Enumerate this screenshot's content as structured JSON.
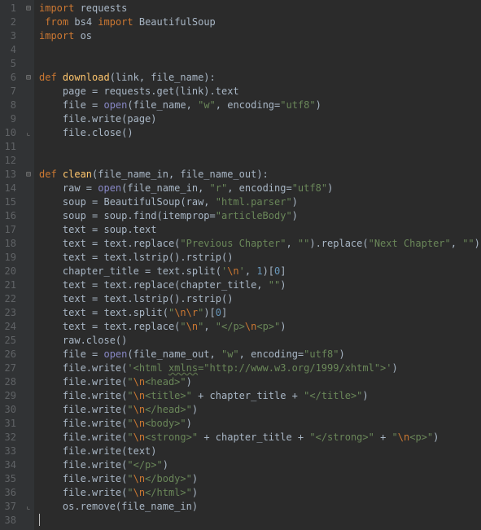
{
  "lines": [
    {
      "n": 1,
      "fold": "minus",
      "html": "<span class='kw'>import</span> requests"
    },
    {
      "n": 2,
      "fold": "",
      "html": " <span class='kw'>from</span> bs4 <span class='kw'>import</span> BeautifulSoup"
    },
    {
      "n": 3,
      "fold": "",
      "html": "<span class='kw'>import</span> os"
    },
    {
      "n": 4,
      "fold": "",
      "html": ""
    },
    {
      "n": 5,
      "fold": "",
      "html": ""
    },
    {
      "n": 6,
      "fold": "minus",
      "html": "<span class='kw'>def </span><span class='fnname'>download</span>(link, file_name):"
    },
    {
      "n": 7,
      "fold": "",
      "html": "    page = requests.get(link).text"
    },
    {
      "n": 8,
      "fold": "",
      "html": "    file = <span class='builtin'>open</span>(file_name, <span class='str'>\"w\"</span>, <span class='param'>encoding</span>=<span class='str'>\"utf8\"</span>)"
    },
    {
      "n": 9,
      "fold": "",
      "html": "    file.write(page)"
    },
    {
      "n": 10,
      "fold": "end",
      "html": "    file.close()"
    },
    {
      "n": 11,
      "fold": "",
      "html": ""
    },
    {
      "n": 12,
      "fold": "",
      "html": ""
    },
    {
      "n": 13,
      "fold": "minus",
      "html": "<span class='kw'>def </span><span class='fnname'>clean</span>(file_name_in, file_name_out):"
    },
    {
      "n": 14,
      "fold": "",
      "html": "    raw = <span class='builtin'>open</span>(file_name_in, <span class='str'>\"r\"</span>, <span class='param'>encoding</span>=<span class='str'>\"utf8\"</span>)"
    },
    {
      "n": 15,
      "fold": "",
      "html": "    soup = BeautifulSoup(raw, <span class='str'>\"html.parser\"</span>)"
    },
    {
      "n": 16,
      "fold": "",
      "html": "    soup = soup.find(<span class='param'>itemprop</span>=<span class='str'>\"articleBody\"</span>)"
    },
    {
      "n": 17,
      "fold": "",
      "html": "    text = soup.text"
    },
    {
      "n": 18,
      "fold": "",
      "html": "    text = text.replace(<span class='str'>\"Previous Chapter\"</span>, <span class='str'>\"\"</span>).replace(<span class='str'>\"Next Chapter\"</span>, <span class='str'>\"\"</span>)"
    },
    {
      "n": 19,
      "fold": "",
      "html": "    text = text.lstrip().rstrip()"
    },
    {
      "n": 20,
      "fold": "",
      "html": "    chapter_title = text.split(<span class='str'>'</span><span class='esc'>\\n</span><span class='str'>'</span>, <span class='num'>1</span>)[<span class='num'>0</span>]"
    },
    {
      "n": 21,
      "fold": "",
      "html": "    text = text.replace(chapter_title, <span class='str'>\"\"</span>)"
    },
    {
      "n": 22,
      "fold": "",
      "html": "    text = text.lstrip().rstrip()"
    },
    {
      "n": 23,
      "fold": "",
      "html": "    text = text.split(<span class='str'>\"</span><span class='esc'>\\n\\r</span><span class='str'>\"</span>)[<span class='num'>0</span>]"
    },
    {
      "n": 24,
      "fold": "",
      "html": "    text = text.replace(<span class='str'>\"</span><span class='esc'>\\n</span><span class='str'>\"</span>, <span class='str'>\"&lt;/p&gt;</span><span class='esc'>\\n</span><span class='str'>&lt;p&gt;\"</span>)"
    },
    {
      "n": 25,
      "fold": "",
      "html": "    raw.close()"
    },
    {
      "n": 26,
      "fold": "",
      "html": "    file = <span class='builtin'>open</span>(file_name_out, <span class='str'>\"w\"</span>, <span class='param'>encoding</span>=<span class='str'>\"utf8\"</span>)"
    },
    {
      "n": 27,
      "fold": "",
      "html": "    file.write(<span class='str'>'&lt;html <span class=\"typo\">xmlns</span>=\"http://www.w3.org/1999/xhtml\"&gt;'</span>)"
    },
    {
      "n": 28,
      "fold": "",
      "html": "    file.write(<span class='str'>\"</span><span class='esc'>\\n</span><span class='str'>&lt;head&gt;\"</span>)"
    },
    {
      "n": 29,
      "fold": "",
      "html": "    file.write(<span class='str'>\"</span><span class='esc'>\\n</span><span class='str'>&lt;title&gt;\"</span> + chapter_title + <span class='str'>\"&lt;/title&gt;\"</span>)"
    },
    {
      "n": 30,
      "fold": "",
      "html": "    file.write(<span class='str'>\"</span><span class='esc'>\\n</span><span class='str'>&lt;/head&gt;\"</span>)"
    },
    {
      "n": 31,
      "fold": "",
      "html": "    file.write(<span class='str'>\"</span><span class='esc'>\\n</span><span class='str'>&lt;body&gt;\"</span>)"
    },
    {
      "n": 32,
      "fold": "",
      "html": "    file.write(<span class='str'>\"</span><span class='esc'>\\n</span><span class='str'>&lt;strong&gt;\"</span> + chapter_title + <span class='str'>\"&lt;/strong&gt;\"</span> + <span class='str'>\"</span><span class='esc'>\\n</span><span class='str'>&lt;p&gt;\"</span>)"
    },
    {
      "n": 33,
      "fold": "",
      "html": "    file.write(text)"
    },
    {
      "n": 34,
      "fold": "",
      "html": "    file.write(<span class='str'>\"&lt;/p&gt;\"</span>)"
    },
    {
      "n": 35,
      "fold": "",
      "html": "    file.write(<span class='str'>\"</span><span class='esc'>\\n</span><span class='str'>&lt;/body&gt;\"</span>)"
    },
    {
      "n": 36,
      "fold": "",
      "html": "    file.write(<span class='str'>\"</span><span class='esc'>\\n</span><span class='str'>&lt;/html&gt;\"</span>)"
    },
    {
      "n": 37,
      "fold": "end",
      "html": "    os.remove(file_name_in)"
    },
    {
      "n": 38,
      "fold": "",
      "html": "<span class='caret'></span>"
    }
  ]
}
